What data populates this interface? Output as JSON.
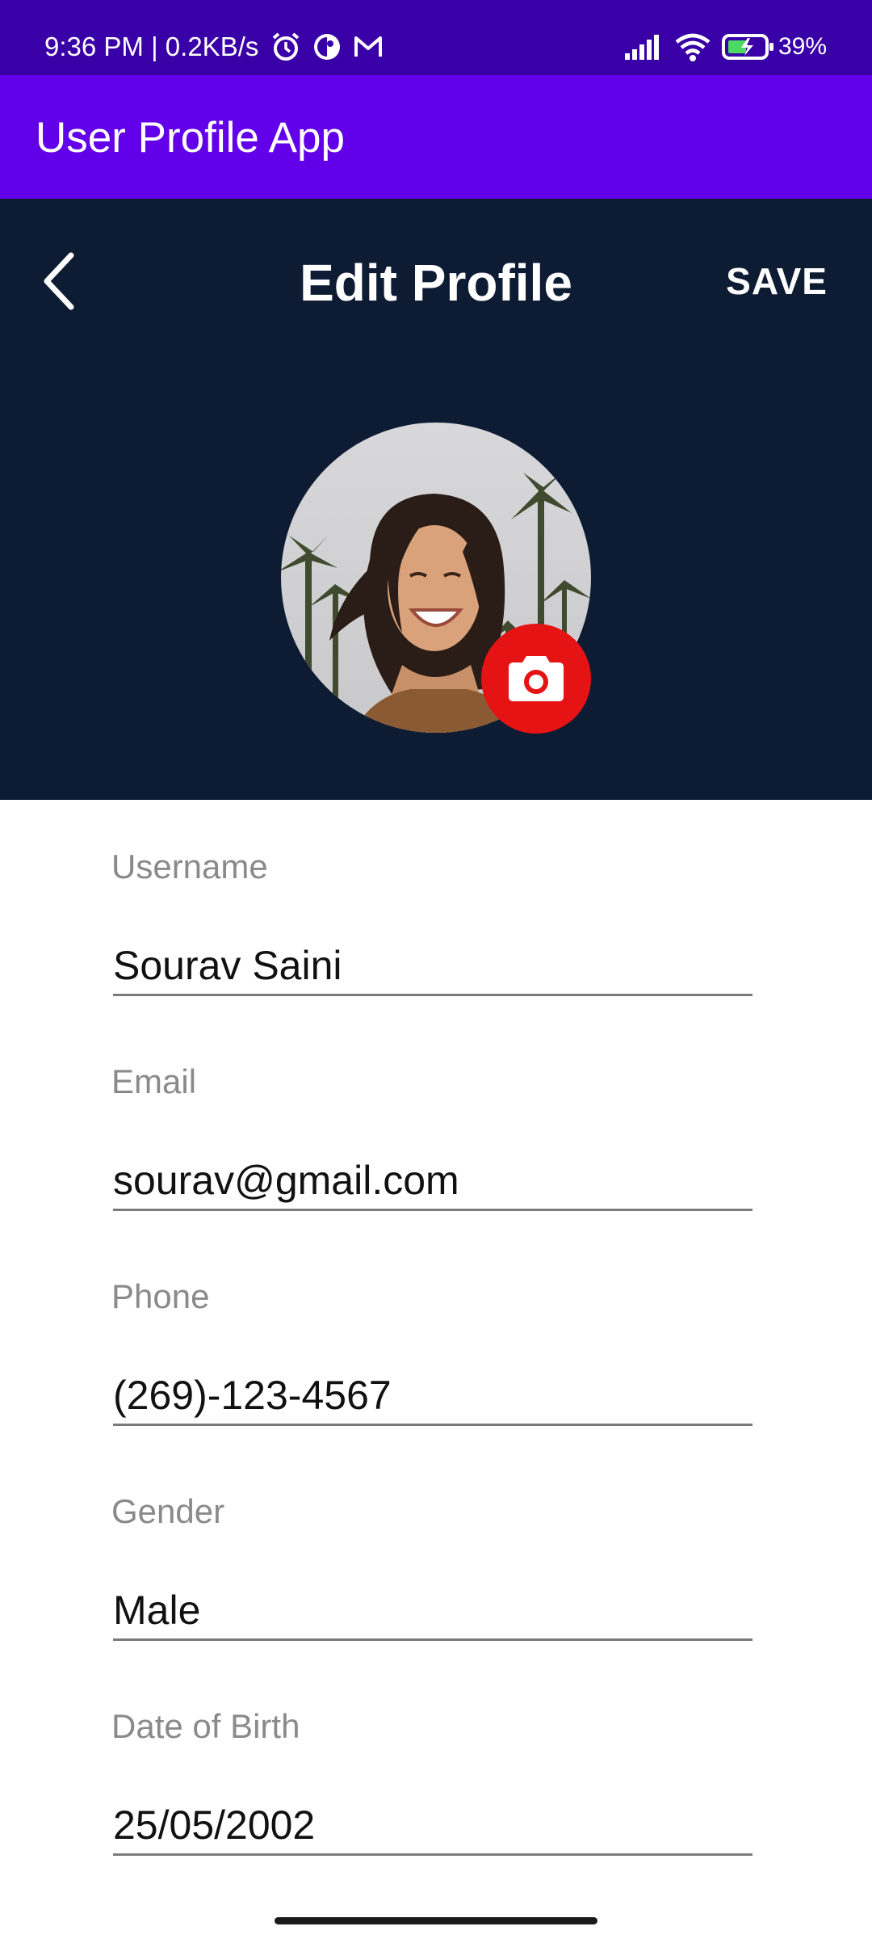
{
  "status_bar": {
    "time_text": "9:36 PM | 0.2KB/s",
    "battery_text": "39%",
    "icons": [
      "alarm-icon",
      "vpn-icon",
      "gmail-icon",
      "signal-icon",
      "wifi-icon",
      "battery-icon"
    ]
  },
  "app_bar": {
    "title": "User Profile App"
  },
  "header": {
    "title": "Edit Profile",
    "save_label": "SAVE",
    "back_icon": "chevron-left-icon",
    "camera_icon": "camera-icon",
    "accent_color": "#e51313",
    "background_color": "#0d1b33"
  },
  "form": {
    "fields": [
      {
        "label": "Username",
        "value": "Sourav Saini"
      },
      {
        "label": "Email",
        "value": "sourav@gmail.com"
      },
      {
        "label": "Phone",
        "value": "(269)-123-4567"
      },
      {
        "label": "Gender",
        "value": "Male"
      },
      {
        "label": "Date of Birth",
        "value": "25/05/2002"
      }
    ]
  },
  "colors": {
    "status_bar": "#3a00a8",
    "app_bar": "#6200ea"
  }
}
